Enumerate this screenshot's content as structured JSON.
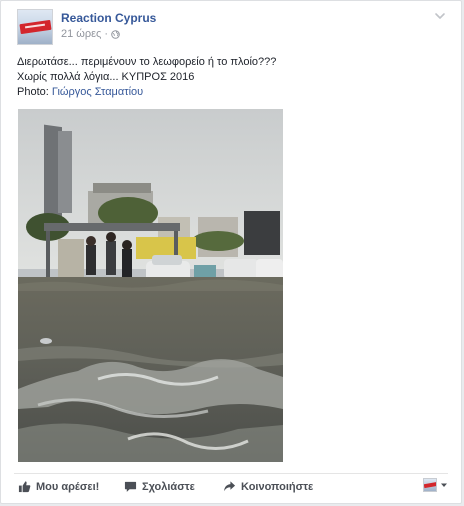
{
  "post": {
    "page_name": "Reaction Cyprus",
    "time": "21 ώρες",
    "separator": "·",
    "privacy_icon": "globe-icon",
    "options_icon": "chevron-down-icon"
  },
  "content": {
    "line1": "Διερωτάσε... περιμένουν το λεωφορείο ή το πλοίο???",
    "line2": "Χωρίς πολλά λόγια... ΚΥΠΡΟΣ 2016",
    "photo_label": "Photo:",
    "photo_credit": "Γιώργος Σταματίου"
  },
  "actions": {
    "like_label": "Μου αρέσει!",
    "comment_label": "Σχολιάστε",
    "share_label": "Κοινοποιήστε",
    "like_icon": "thumbs-up-icon",
    "comment_icon": "speech-bubble-icon",
    "share_icon": "share-arrow-icon"
  },
  "colors": {
    "link": "#365899",
    "meta": "#90949c",
    "text": "#1d2129",
    "action_text": "#4b4f56",
    "avatar_accent": "#d3262c"
  }
}
